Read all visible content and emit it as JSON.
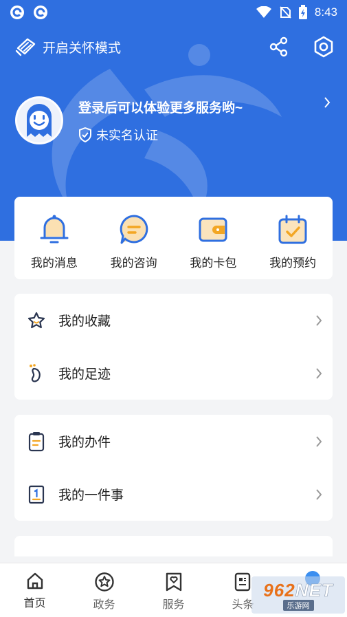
{
  "status": {
    "time": "8:43"
  },
  "header": {
    "care_mode": "开启关怀模式",
    "share_icon": "share-icon",
    "settings_icon": "settings-hexagon-icon"
  },
  "profile": {
    "login_tip": "登录后可以体验更多服务哟~",
    "realname_status": "未实名认证"
  },
  "quick_actions": [
    {
      "label": "我的消息",
      "icon": "bell-icon"
    },
    {
      "label": "我的咨询",
      "icon": "chat-bubble-icon"
    },
    {
      "label": "我的卡包",
      "icon": "wallet-icon"
    },
    {
      "label": "我的预约",
      "icon": "calendar-check-icon"
    }
  ],
  "list_group_1": [
    {
      "label": "我的收藏",
      "icon": "star-icon"
    },
    {
      "label": "我的足迹",
      "icon": "footprint-icon"
    }
  ],
  "list_group_2": [
    {
      "label": "我的办件",
      "icon": "document-icon"
    },
    {
      "label": "我的一件事",
      "icon": "numbered-doc-icon"
    }
  ],
  "tabbar": [
    {
      "label": "首页",
      "icon": "home-icon"
    },
    {
      "label": "政务",
      "icon": "star-circle-icon"
    },
    {
      "label": "服务",
      "icon": "heart-bookmark-icon"
    },
    {
      "label": "头条",
      "icon": "news-icon"
    }
  ],
  "watermark": {
    "main_a": "962",
    "main_b": "NET",
    "sub": "乐游网"
  },
  "colors": {
    "primary": "#2f6fe0",
    "accent_orange": "#f3a623",
    "background": "#f3f4f6"
  }
}
